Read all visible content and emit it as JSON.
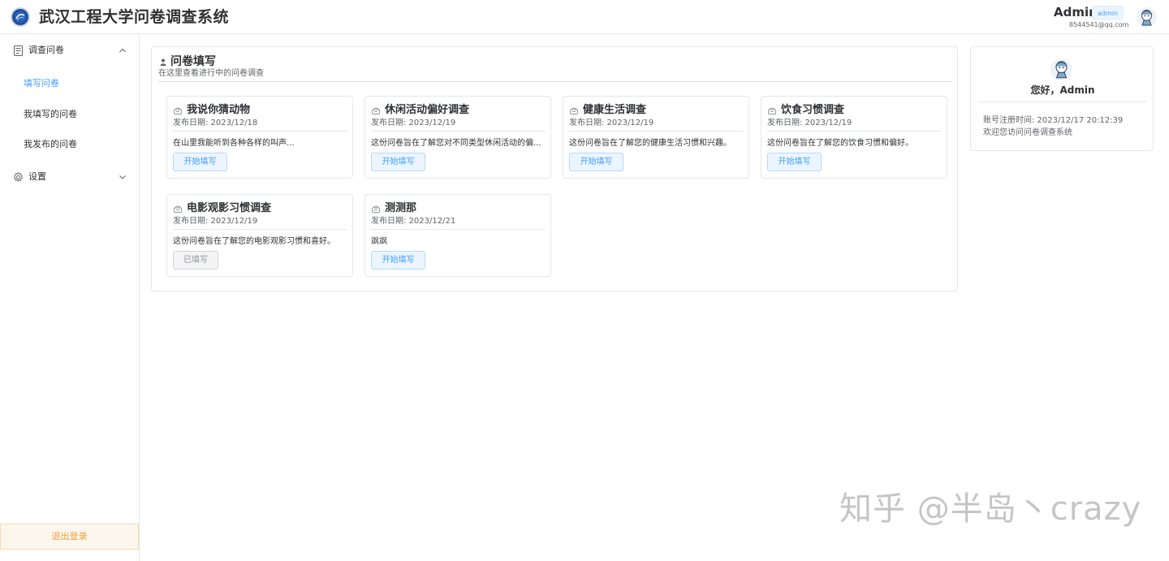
{
  "header": {
    "app_title": "武汉工程大学问卷调查系统",
    "user_name": "Admin",
    "user_role": "admin",
    "user_email": "8544541@qq.com"
  },
  "sidebar": {
    "groups": [
      {
        "label": "调查问卷",
        "icon": "document-icon",
        "expanded": true,
        "items": [
          {
            "label": "填写问卷",
            "active": true
          },
          {
            "label": "我填写的问卷",
            "active": false
          },
          {
            "label": "我发布的问卷",
            "active": false
          }
        ]
      },
      {
        "label": "设置",
        "icon": "gear-icon",
        "expanded": false,
        "items": []
      }
    ],
    "logout_label": "退出登录"
  },
  "main": {
    "title": "问卷填写",
    "subtitle": "在这里查看进行中的问卷调查",
    "surveys": [
      {
        "title": "我说你猜动物",
        "date": "发布日期: 2023/12/18",
        "desc": "在山里我能听到各种各样的叫声...",
        "button": "开始填写",
        "filled": false
      },
      {
        "title": "休闲活动偏好调查",
        "date": "发布日期: 2023/12/19",
        "desc": "这份问卷旨在了解您对不同类型休闲活动的偏...",
        "button": "开始填写",
        "filled": false
      },
      {
        "title": "健康生活调查",
        "date": "发布日期: 2023/12/19",
        "desc": "这份问卷旨在了解您的健康生活习惯和兴趣。",
        "button": "开始填写",
        "filled": false
      },
      {
        "title": "饮食习惯调查",
        "date": "发布日期: 2023/12/19",
        "desc": "这份问卷旨在了解您的饮食习惯和偏好。",
        "button": "开始填写",
        "filled": false
      },
      {
        "title": "电影观影习惯调查",
        "date": "发布日期: 2023/12/19",
        "desc": "这份问卷旨在了解您的电影观影习惯和喜好。",
        "button": "已填写",
        "filled": true
      },
      {
        "title": "测测那",
        "date": "发布日期: 2023/12/21",
        "desc": "飒飒",
        "button": "开始填写",
        "filled": false
      }
    ]
  },
  "profile": {
    "greeting": "您好，Admin",
    "register_time": "账号注册时间: 2023/12/17 20:12:39",
    "welcome": "欢迎您访问问卷调查系统"
  },
  "watermark": "知乎 @半岛丶crazy",
  "colors": {
    "primary": "#409eff",
    "warning": "#e6a23c",
    "border": "#e4e7ed"
  }
}
